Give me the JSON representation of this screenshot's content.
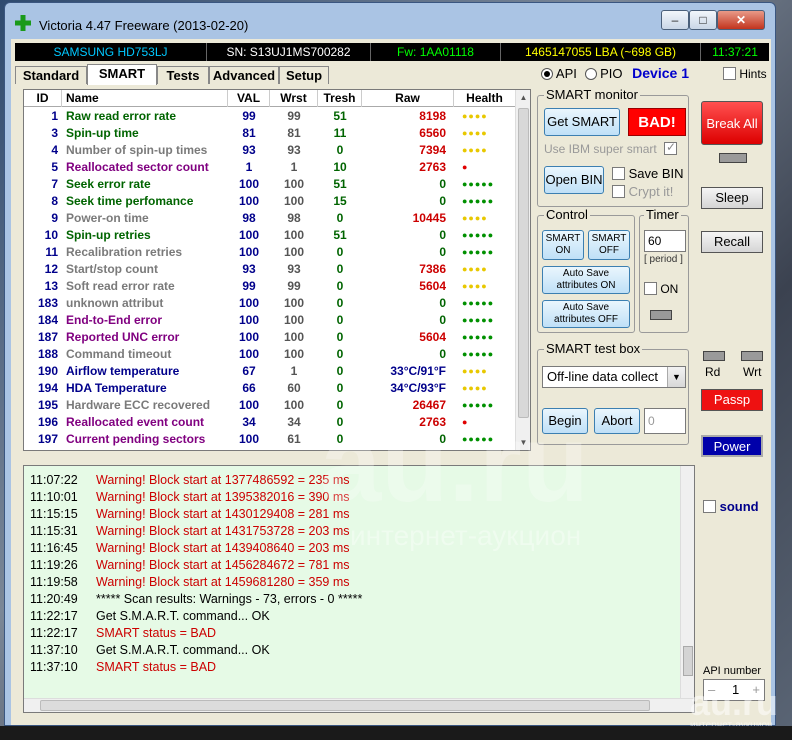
{
  "window": {
    "title": "Victoria 4.47  Freeware (2013-02-20)",
    "min_label": "–",
    "max_label": "□",
    "close_label": "✕"
  },
  "infobar": {
    "model": "SAMSUNG HD753LJ",
    "serial": "SN: S13UJ1MS700282",
    "firmware": "Fw: 1AA01118",
    "lba": "1465147055 LBA (~698 GB)",
    "time": "11:37:21"
  },
  "tabs": [
    "Standard",
    "SMART",
    "Tests",
    "Advanced",
    "Setup"
  ],
  "mode": {
    "api": "API",
    "pio": "PIO",
    "device": "Device 1",
    "hints": "Hints"
  },
  "table": {
    "headers": [
      "ID",
      "Name",
      "VAL",
      "Wrst",
      "Tresh",
      "Raw",
      "Health"
    ],
    "rows": [
      {
        "id": "1",
        "name": "Raw read error rate",
        "val": "99",
        "wrst": "99",
        "tresh": "51",
        "raw": "8198",
        "health": "●●●●",
        "name_color": "#006400",
        "health_color": "#e8c800"
      },
      {
        "id": "3",
        "name": "Spin-up time",
        "val": "81",
        "wrst": "81",
        "tresh": "11",
        "raw": "6560",
        "health": "●●●●",
        "name_color": "#006400",
        "health_color": "#e8c800"
      },
      {
        "id": "4",
        "name": "Number of spin-up times",
        "val": "93",
        "wrst": "93",
        "tresh": "0",
        "raw": "7394",
        "health": "●●●●",
        "name_color": "#7a7a7a",
        "health_color": "#e8c800"
      },
      {
        "id": "5",
        "name": "Reallocated sector count",
        "val": "1",
        "wrst": "1",
        "tresh": "10",
        "raw": "2763",
        "health": "●",
        "name_color": "#800080",
        "health_color": "#e00000"
      },
      {
        "id": "7",
        "name": "Seek error rate",
        "val": "100",
        "wrst": "100",
        "tresh": "51",
        "raw": "0",
        "health": "●●●●●",
        "name_color": "#006400",
        "health_color": "#009000"
      },
      {
        "id": "8",
        "name": "Seek time perfomance",
        "val": "100",
        "wrst": "100",
        "tresh": "15",
        "raw": "0",
        "health": "●●●●●",
        "name_color": "#006400",
        "health_color": "#009000"
      },
      {
        "id": "9",
        "name": "Power-on time",
        "val": "98",
        "wrst": "98",
        "tresh": "0",
        "raw": "10445",
        "health": "●●●●",
        "name_color": "#7a7a7a",
        "health_color": "#e8c800"
      },
      {
        "id": "10",
        "name": "Spin-up retries",
        "val": "100",
        "wrst": "100",
        "tresh": "51",
        "raw": "0",
        "health": "●●●●●",
        "name_color": "#006400",
        "health_color": "#009000"
      },
      {
        "id": "11",
        "name": "Recalibration retries",
        "val": "100",
        "wrst": "100",
        "tresh": "0",
        "raw": "0",
        "health": "●●●●●",
        "name_color": "#7a7a7a",
        "health_color": "#009000"
      },
      {
        "id": "12",
        "name": "Start/stop count",
        "val": "93",
        "wrst": "93",
        "tresh": "0",
        "raw": "7386",
        "health": "●●●●",
        "name_color": "#7a7a7a",
        "health_color": "#e8c800"
      },
      {
        "id": "13",
        "name": "Soft read error rate",
        "val": "99",
        "wrst": "99",
        "tresh": "0",
        "raw": "5604",
        "health": "●●●●",
        "name_color": "#7a7a7a",
        "health_color": "#e8c800"
      },
      {
        "id": "183",
        "name": "unknown attribut",
        "val": "100",
        "wrst": "100",
        "tresh": "0",
        "raw": "0",
        "health": "●●●●●",
        "name_color": "#7a7a7a",
        "health_color": "#009000"
      },
      {
        "id": "184",
        "name": "End-to-End error",
        "val": "100",
        "wrst": "100",
        "tresh": "0",
        "raw": "0",
        "health": "●●●●●",
        "name_color": "#800080",
        "health_color": "#009000"
      },
      {
        "id": "187",
        "name": "Reported UNC error",
        "val": "100",
        "wrst": "100",
        "tresh": "0",
        "raw": "5604",
        "health": "●●●●●",
        "name_color": "#800080",
        "health_color": "#009000"
      },
      {
        "id": "188",
        "name": "Command timeout",
        "val": "100",
        "wrst": "100",
        "tresh": "0",
        "raw": "0",
        "health": "●●●●●",
        "name_color": "#7a7a7a",
        "health_color": "#009000"
      },
      {
        "id": "190",
        "name": "Airflow temperature",
        "val": "67",
        "wrst": "1",
        "tresh": "0",
        "raw": "33°C/91°F",
        "health": "●●●●",
        "name_color": "#00008b",
        "health_color": "#e8c800",
        "raw_color": "#00008b"
      },
      {
        "id": "194",
        "name": "HDA Temperature",
        "val": "66",
        "wrst": "60",
        "tresh": "0",
        "raw": "34°C/93°F",
        "health": "●●●●",
        "name_color": "#00008b",
        "health_color": "#e8c800",
        "raw_color": "#00008b"
      },
      {
        "id": "195",
        "name": "Hardware ECC recovered",
        "val": "100",
        "wrst": "100",
        "tresh": "0",
        "raw": "26467",
        "health": "●●●●●",
        "name_color": "#7a7a7a",
        "health_color": "#009000"
      },
      {
        "id": "196",
        "name": "Reallocated event count",
        "val": "34",
        "wrst": "34",
        "tresh": "0",
        "raw": "2763",
        "health": "●",
        "name_color": "#800080",
        "health_color": "#e00000"
      },
      {
        "id": "197",
        "name": "Current pending sectors",
        "val": "100",
        "wrst": "61",
        "tresh": "0",
        "raw": "0",
        "health": "●●●●●",
        "name_color": "#800080",
        "health_color": "#009000"
      }
    ]
  },
  "smart_monitor": {
    "label": "SMART monitor",
    "get_smart": "Get SMART",
    "status": "BAD!",
    "ibm": "Use IBM super smart",
    "open_bin": "Open BIN",
    "save_bin": "Save BIN",
    "crypt": "Crypt it!"
  },
  "control": {
    "label": "Control",
    "smart_on": "SMART ON",
    "smart_off": "SMART OFF",
    "autosave_on": "Auto Save attributes ON",
    "autosave_off": "Auto Save attributes OFF"
  },
  "timer": {
    "label": "Timer",
    "value": "60",
    "period": "[ period ]",
    "on": "ON"
  },
  "test_box": {
    "label": "SMART test box",
    "selected": "Off-line data collect",
    "begin": "Begin",
    "abort": "Abort",
    "progress": "0"
  },
  "side": {
    "break_all": "Break All",
    "sleep": "Sleep",
    "recall": "Recall",
    "rd": "Rd",
    "wrt": "Wrt",
    "passp": "Passp",
    "power": "Power",
    "sound": "sound",
    "api_number_label": "API number",
    "api_number": "1",
    "minus": "–",
    "plus": "+"
  },
  "log": [
    {
      "time": "11:07:22",
      "msg": "Warning! Block start at 1377486592 = 235 ms",
      "color": "#cc0000"
    },
    {
      "time": "11:10:01",
      "msg": "Warning! Block start at 1395382016 = 390 ms",
      "color": "#cc0000"
    },
    {
      "time": "11:15:15",
      "msg": "Warning! Block start at 1430129408 = 281 ms",
      "color": "#cc0000"
    },
    {
      "time": "11:15:31",
      "msg": "Warning! Block start at 1431753728 = 203 ms",
      "color": "#cc0000"
    },
    {
      "time": "11:16:45",
      "msg": "Warning! Block start at 1439408640 = 203 ms",
      "color": "#cc0000"
    },
    {
      "time": "11:19:26",
      "msg": "Warning! Block start at 1456284672 = 781 ms",
      "color": "#cc0000"
    },
    {
      "time": "11:19:58",
      "msg": "Warning! Block start at 1459681280 = 359 ms",
      "color": "#cc0000"
    },
    {
      "time": "11:20:49",
      "msg": "***** Scan results: Warnings - 73, errors - 0 *****",
      "color": "#000000"
    },
    {
      "time": "11:22:17",
      "msg": "Get S.M.A.R.T. command... OK",
      "color": "#000000"
    },
    {
      "time": "11:22:17",
      "msg": "SMART status = BAD",
      "color": "#cc0000"
    },
    {
      "time": "11:37:10",
      "msg": "Get S.M.A.R.T. command... OK",
      "color": "#000000"
    },
    {
      "time": "11:37:10",
      "msg": "SMART status = BAD",
      "color": "#cc0000"
    }
  ],
  "watermark": {
    "main": "au.ru",
    "sub": "интернет-аукцион"
  },
  "colors": {
    "infobar_model": "#00c8ff",
    "infobar_serial": "#ffffff",
    "infobar_fw": "#00ff00",
    "infobar_lba": "#ffff00",
    "infobar_time": "#00ff00",
    "bad": "#ff0000",
    "break_all": "#ff2020",
    "passp": "#ee1111",
    "power": "#0000aa"
  }
}
